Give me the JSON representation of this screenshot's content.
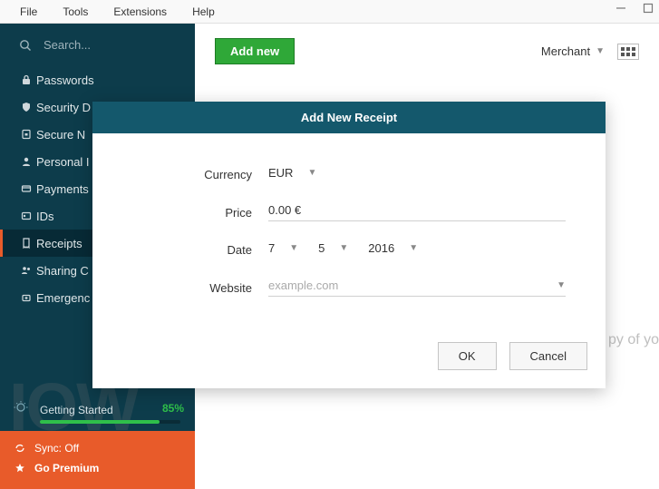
{
  "menubar": {
    "file": "File",
    "tools": "Tools",
    "extensions": "Extensions",
    "help": "Help"
  },
  "search": {
    "placeholder": "Search..."
  },
  "sidebar": {
    "items": [
      {
        "label": "Passwords"
      },
      {
        "label": "Security D"
      },
      {
        "label": "Secure N"
      },
      {
        "label": "Personal I"
      },
      {
        "label": "Payments"
      },
      {
        "label": "IDs"
      },
      {
        "label": "Receipts"
      },
      {
        "label": "Sharing C"
      },
      {
        "label": "Emergenc"
      }
    ]
  },
  "getting_started": {
    "label": "Getting Started",
    "percent": "85%"
  },
  "premium": {
    "sync": "Sync: Off",
    "go": "Go Premium"
  },
  "topbar": {
    "add_new": "Add new",
    "sort_label": "Merchant"
  },
  "hint": "py of yo",
  "watermark": "IOW",
  "modal": {
    "title": "Add New Receipt",
    "labels": {
      "currency": "Currency",
      "price": "Price",
      "date": "Date",
      "website": "Website"
    },
    "currency_value": "EUR",
    "price_value": "0.00 €",
    "date": {
      "day": "7",
      "month": "5",
      "year": "2016"
    },
    "website_placeholder": "example.com",
    "ok": "OK",
    "cancel": "Cancel"
  }
}
